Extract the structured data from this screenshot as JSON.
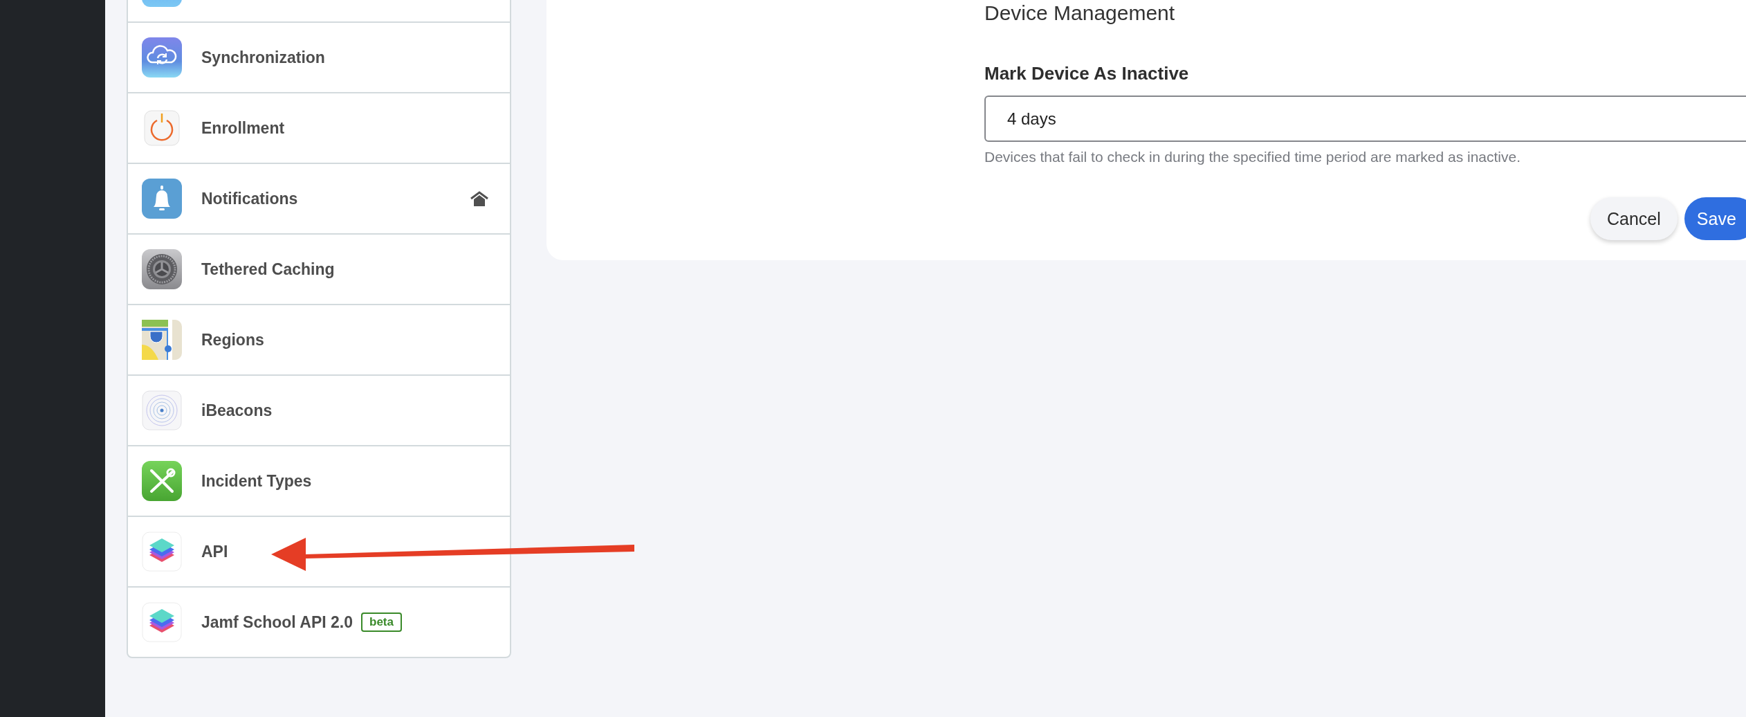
{
  "sidebar": {
    "items": [
      {
        "label": "Synchronization"
      },
      {
        "label": "Enrollment"
      },
      {
        "label": "Notifications"
      },
      {
        "label": "Tethered Caching"
      },
      {
        "label": "Regions"
      },
      {
        "label": "iBeacons"
      },
      {
        "label": "Incident Types"
      },
      {
        "label": "API"
      },
      {
        "label": "Jamf School API 2.0",
        "tag": "beta"
      }
    ]
  },
  "panel": {
    "section_title": "Device Management",
    "field": {
      "label": "Mark Device As Inactive",
      "value": "4 days",
      "help": "Devices that fail to check in during the specified time period are marked as inactive."
    },
    "buttons": [
      {
        "label": "Cancel",
        "kind": "secondary"
      },
      {
        "label": "Save",
        "kind": "primary"
      }
    ]
  },
  "annotation": {
    "kind": "arrow"
  }
}
